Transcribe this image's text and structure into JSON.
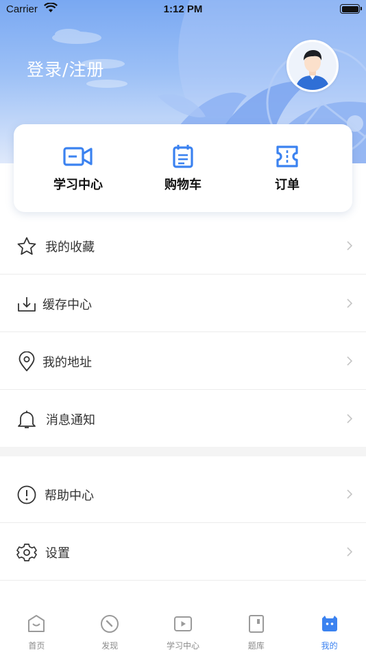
{
  "status_bar": {
    "carrier": "Carrier",
    "time": "1:12 PM"
  },
  "header": {
    "login_text": "登录/注册"
  },
  "quick_actions": [
    {
      "label": "学习中心",
      "icon": "video-camera-icon"
    },
    {
      "label": "购物车",
      "icon": "calendar-list-icon"
    },
    {
      "label": "订单",
      "icon": "ticket-icon"
    }
  ],
  "menu": [
    {
      "label": "我的收藏",
      "icon": "star-icon"
    },
    {
      "label": "缓存中心",
      "icon": "download-icon"
    },
    {
      "label": "我的地址",
      "icon": "location-pin-icon"
    },
    {
      "label": "消息通知",
      "icon": "bell-icon"
    },
    {
      "label": "帮助中心",
      "icon": "exclamation-circle-icon"
    },
    {
      "label": "设置",
      "icon": "settings-gear-icon"
    }
  ],
  "tabbar": {
    "items": [
      {
        "label": "首页",
        "icon": "home-icon",
        "active": false
      },
      {
        "label": "发现",
        "icon": "compass-icon",
        "active": false
      },
      {
        "label": "学习中心",
        "icon": "play-icon",
        "active": false
      },
      {
        "label": "题库",
        "icon": "book-icon",
        "active": false
      },
      {
        "label": "我的",
        "icon": "profile-icon",
        "active": true
      }
    ]
  },
  "colors": {
    "accent": "#3b82f0",
    "header_top": "#79a8f2"
  }
}
